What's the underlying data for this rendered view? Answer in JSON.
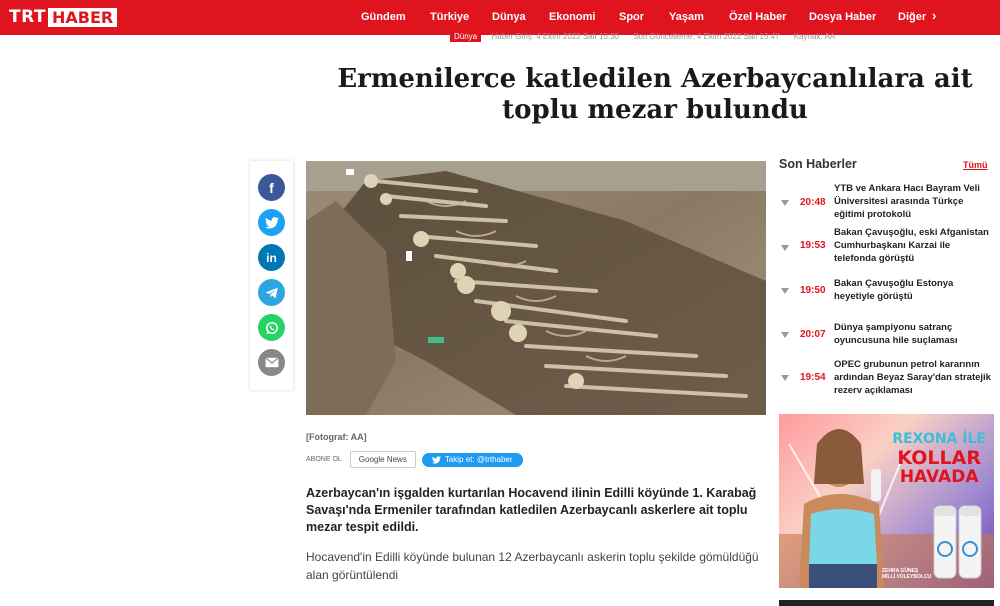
{
  "header": {
    "logo_trt": "TRT",
    "logo_haber": "HABER",
    "nav": [
      "Gündem",
      "Türkiye",
      "Dünya",
      "Ekonomi",
      "Spor",
      "Yaşam",
      "Özel Haber",
      "Dosya Haber",
      "Diğer"
    ],
    "nav_more_icon": "chevron-right-icon"
  },
  "meta": {
    "category": "Dünya",
    "published": "Haber Giriş: 4 Ekim 2022 Salı 15:30",
    "updated": "Son Güncelleme: 4 Ekim 2022 Salı 15:47",
    "source": "Kaynak: AA"
  },
  "article": {
    "title": "Ermenilerce katledilen Azerbaycanlılara ait toplu mezar bulundu",
    "caption": "[Fotograf: AA]",
    "subscribe_label": "ABONE OL",
    "google_news": "Google News",
    "twitter_follow": "Takip et: @trthaber",
    "lead": "Azerbaycan'ın işgalden kurtarılan Hocavend ilinin Edilli köyünde 1. Karabağ Savaşı'nda Ermeniler tarafından katledilen Azerbaycanlı askerlere ait toplu mezar tespit edildi.",
    "body": "Hocavend'in Edilli köyünde bulunan 12 Azerbaycanlı askerin toplu şekilde gömüldüğü alan görüntülendi"
  },
  "share": {
    "buttons": [
      {
        "icon": "facebook-icon",
        "glyph": "f",
        "color": "#3b5998"
      },
      {
        "icon": "twitter-icon",
        "glyph": "t",
        "color": "#1da1f2"
      },
      {
        "icon": "linkedin-icon",
        "glyph": "in",
        "color": "#0077b5"
      },
      {
        "icon": "telegram-icon",
        "glyph": "➤",
        "color": "#2ca5e0"
      },
      {
        "icon": "whatsapp-icon",
        "glyph": "✆",
        "color": "#25d366"
      },
      {
        "icon": "email-icon",
        "glyph": "✉",
        "color": "#777777"
      }
    ]
  },
  "sidebar": {
    "title": "Son Haberler",
    "all_link": "Tümü",
    "items": [
      {
        "time": "20:48",
        "text": "YTB ve Ankara Hacı Bayram Veli Üniversitesi arasında Türkçe eğitimi protokolü"
      },
      {
        "time": "19:53",
        "text": "Bakan Çavuşoğlu, eski Afganistan Cumhurbaşkanı Karzai ile telefonda görüştü"
      },
      {
        "time": "19:50",
        "text": "Bakan Çavuşoğlu Estonya heyetiyle görüştü"
      },
      {
        "time": "20:07",
        "text": "Dünya şampiyonu satranç oyuncusuna hile suçlaması"
      },
      {
        "time": "19:54",
        "text": "OPEC grubunun petrol kararının ardından Beyaz Saray'dan stratejik rezerv açıklaması"
      }
    ]
  },
  "ad": {
    "line1": "REXONA İLE",
    "line2": "KOLLAR",
    "line3": "HAVADA",
    "person_name": "ZEHRA GÜNEŞ",
    "person_role": "MİLLİ VOLEYBOLCU"
  }
}
